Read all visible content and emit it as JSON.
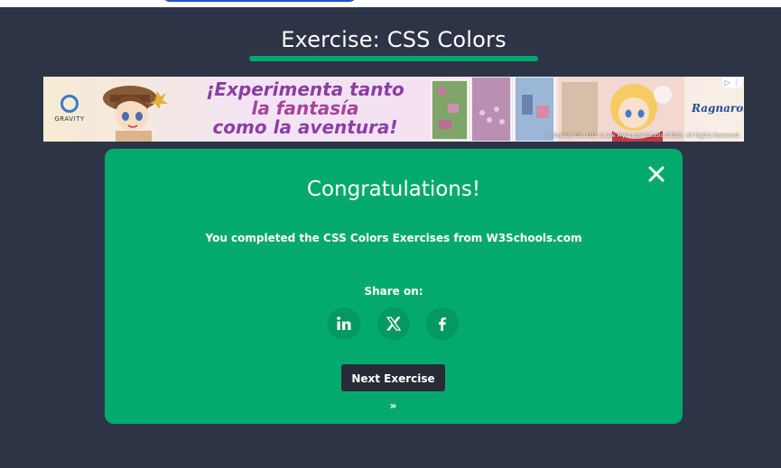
{
  "page": {
    "heading": "Exercise: CSS Colors",
    "accent_color": "#04aa6d",
    "background_color": "#2d3446"
  },
  "ad": {
    "brand": "GRAVITY",
    "slogan_line1": "¡Experimenta tanto",
    "slogan_line2": "la fantasía",
    "slogan_line3": "como la aventura!",
    "game_logo": "Ragnarok",
    "copyright": "© Gravity Co., LTD. & Lee MyoungJin(studio DTDS). All Rights Reserved.",
    "adchoices": "▷ ⋮"
  },
  "modal": {
    "title": "Congratulations!",
    "message": "You completed the CSS Colors Exercises from W3Schools.com",
    "share_label": "Share on:",
    "close_icon": "close-icon",
    "share_buttons": [
      {
        "icon": "linkedin-icon"
      },
      {
        "icon": "x-twitter-icon"
      },
      {
        "icon": "facebook-icon"
      }
    ],
    "next_button": "Next Exercise »",
    "background_color": "#04aa6d"
  }
}
